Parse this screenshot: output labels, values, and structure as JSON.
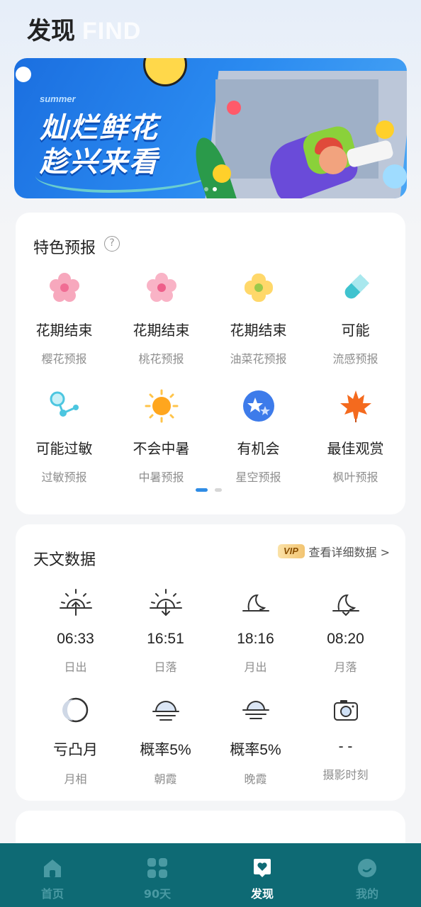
{
  "header": {
    "title": "发现",
    "subtitle": "FIND"
  },
  "banner": {
    "small_text": "summer",
    "line1": "灿烂鲜花",
    "line2": "趁兴来看",
    "slide_count": 2,
    "active_slide": 2
  },
  "features": {
    "title": "特色预报",
    "help_icon": "question-circle-icon",
    "items": [
      {
        "main": "花期结束",
        "sub": "樱花预报",
        "icon": "sakura-flower-icon"
      },
      {
        "main": "花期结束",
        "sub": "桃花预报",
        "icon": "peach-blossom-icon"
      },
      {
        "main": "花期结束",
        "sub": "油菜花预报",
        "icon": "rapeseed-flower-icon"
      },
      {
        "main": "可能",
        "sub": "流感预报",
        "icon": "capsule-pill-icon"
      },
      {
        "main": "可能过敏",
        "sub": "过敏预报",
        "icon": "pollen-molecule-icon"
      },
      {
        "main": "不会中暑",
        "sub": "中暑预报",
        "icon": "sun-icon"
      },
      {
        "main": "有机会",
        "sub": "星空预报",
        "icon": "stars-icon"
      },
      {
        "main": "最佳观赏",
        "sub": "枫叶预报",
        "icon": "maple-leaf-icon"
      }
    ],
    "page_count": 2,
    "active_page": 1
  },
  "astro": {
    "title": "天文数据",
    "vip_badge": "VIP",
    "detail_link": "查看详细数据 >",
    "items": [
      {
        "value": "06:33",
        "label": "日出",
        "icon": "sunrise-icon"
      },
      {
        "value": "16:51",
        "label": "日落",
        "icon": "sunset-icon"
      },
      {
        "value": "18:16",
        "label": "月出",
        "icon": "moonrise-icon"
      },
      {
        "value": "08:20",
        "label": "月落",
        "icon": "moonset-icon"
      },
      {
        "value": "亏凸月",
        "label": "月相",
        "icon": "moon-phase-icon"
      },
      {
        "value": "概率5%",
        "label": "朝霞",
        "icon": "morning-glow-icon"
      },
      {
        "value": "概率5%",
        "label": "晚霞",
        "icon": "evening-glow-icon"
      },
      {
        "value": "- -",
        "label": "摄影时刻",
        "icon": "camera-icon"
      }
    ]
  },
  "nav": {
    "items": [
      {
        "label": "首页",
        "icon": "home-icon",
        "active": false
      },
      {
        "label": "90天",
        "icon": "grid-icon",
        "active": false
      },
      {
        "label": "发现",
        "icon": "discover-heart-icon",
        "active": true
      },
      {
        "label": "我的",
        "icon": "profile-icon",
        "active": false
      }
    ]
  },
  "colors": {
    "accent": "#2f8ce5",
    "nav_bg": "#0e6a74",
    "nav_inactive": "#4a9aa3",
    "nav_active": "#ffffff"
  }
}
